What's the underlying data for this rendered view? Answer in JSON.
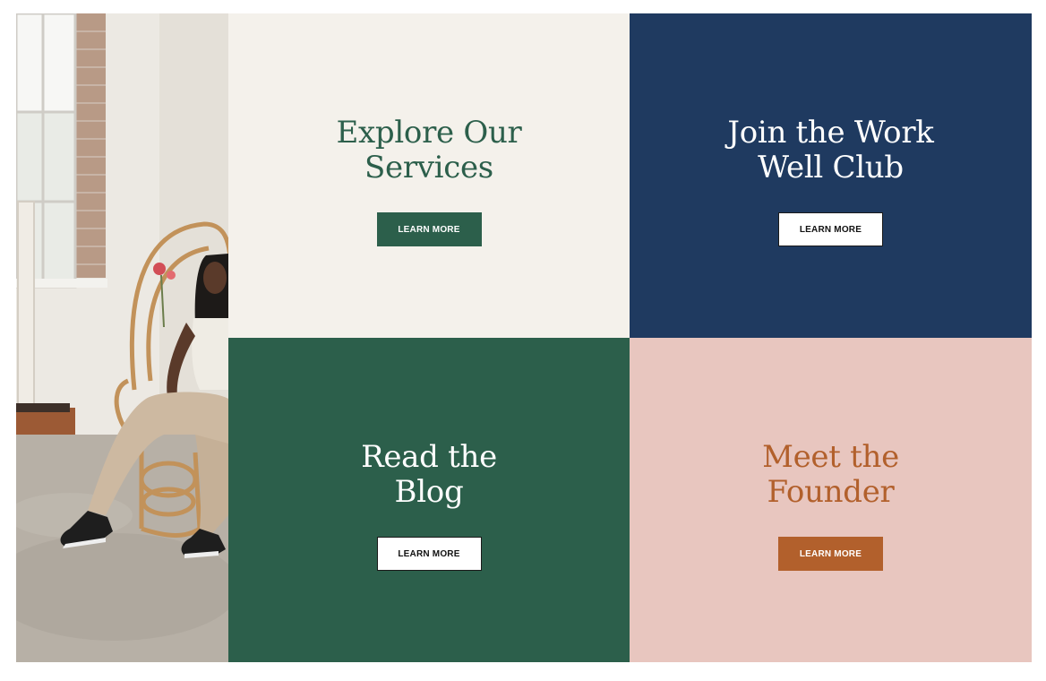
{
  "colors": {
    "cream": "#f4f1eb",
    "navy": "#1f3a60",
    "green": "#2c5f4b",
    "pink": "#e8c6bf",
    "rust": "#b2602c",
    "white": "#ffffff",
    "black": "#111111"
  },
  "photo": {
    "alt": "woman-seated-in-rattan-chair-photo"
  },
  "tiles": [
    {
      "id": "services",
      "title": "Explore Our\nServices",
      "button_label": "LEARN MORE",
      "bg": "#f4f1eb",
      "title_color": "#2c5f4b",
      "button_style": "solid",
      "button_bg": "#2c5f4b",
      "button_color": "#ffffff"
    },
    {
      "id": "club",
      "title": "Join the Work\nWell Club",
      "button_label": "LEARN MORE",
      "bg": "#1f3a60",
      "title_color": "#ffffff",
      "button_style": "outline",
      "button_bg": "#ffffff",
      "button_color": "#111111"
    },
    {
      "id": "blog",
      "title": "Read the\nBlog",
      "button_label": "LEARN MORE",
      "bg": "#2c5f4b",
      "title_color": "#ffffff",
      "button_style": "outline",
      "button_bg": "#ffffff",
      "button_color": "#111111"
    },
    {
      "id": "founder",
      "title": "Meet the\nFounder",
      "button_label": "LEARN MORE",
      "bg": "#e8c6bf",
      "title_color": "#b2602c",
      "button_style": "solid",
      "button_bg": "#b2602c",
      "button_color": "#ffffff"
    }
  ]
}
